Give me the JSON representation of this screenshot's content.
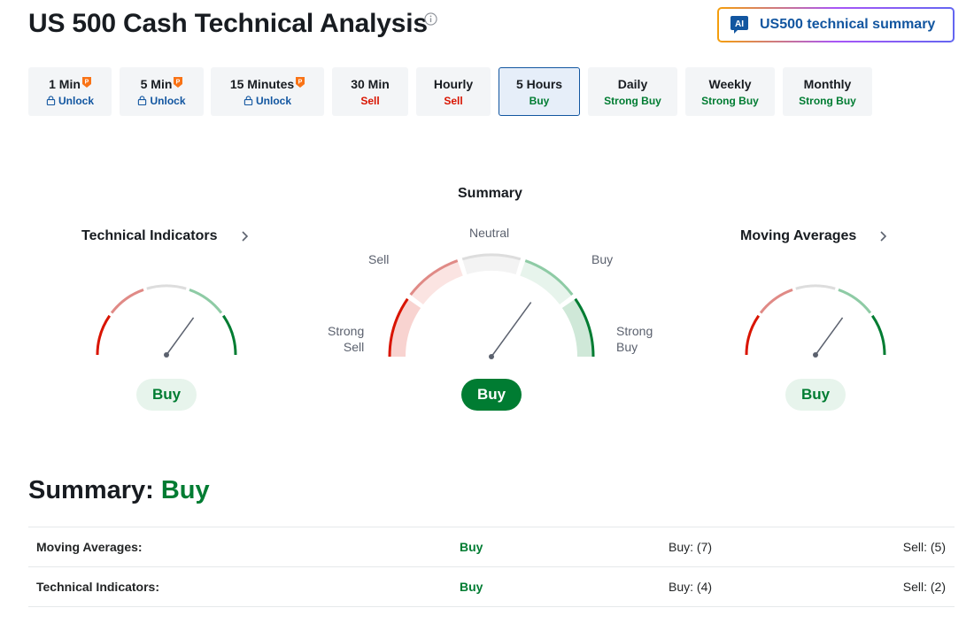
{
  "header": {
    "title": "US 500 Cash Technical Analysis",
    "ai_badge": "AI",
    "ai_summary_label": "US500 technical summary"
  },
  "timeframes": [
    {
      "name": "1 Min",
      "status": "Unlock",
      "locked": true
    },
    {
      "name": "5 Min",
      "status": "Unlock",
      "locked": true
    },
    {
      "name": "15 Minutes",
      "status": "Unlock",
      "locked": true
    },
    {
      "name": "30 Min",
      "status": "Sell",
      "locked": false
    },
    {
      "name": "Hourly",
      "status": "Sell",
      "locked": false
    },
    {
      "name": "5 Hours",
      "status": "Buy",
      "locked": false,
      "active": true
    },
    {
      "name": "Daily",
      "status": "Strong Buy",
      "locked": false
    },
    {
      "name": "Weekly",
      "status": "Strong Buy",
      "locked": false
    },
    {
      "name": "Monthly",
      "status": "Strong Buy",
      "locked": false
    }
  ],
  "gauges": {
    "technical_indicators": {
      "title": "Technical Indicators",
      "result": "Buy",
      "needle": 0.7
    },
    "summary": {
      "title": "Summary",
      "result": "Buy",
      "needle": 0.7,
      "labels": {
        "neutral": "Neutral",
        "sell": "Sell",
        "buy": "Buy",
        "strong_sell": "Strong\nSell",
        "strong_buy": "Strong\nBuy"
      }
    },
    "moving_averages": {
      "title": "Moving Averages",
      "result": "Buy",
      "needle": 0.7
    }
  },
  "summary": {
    "label": "Summary:",
    "value": "Buy",
    "rows": [
      {
        "name": "Moving Averages:",
        "result": "Buy",
        "buy": "Buy: (7)",
        "sell": "Sell: (5)"
      },
      {
        "name": "Technical Indicators:",
        "result": "Buy",
        "buy": "Buy: (4)",
        "sell": "Sell: (2)"
      }
    ]
  },
  "colors": {
    "strong_sell": "#d91400",
    "sell": "#e08a86",
    "neutral": "#dddddd",
    "buy": "#8ecba5",
    "strong_buy": "#007c32",
    "accent": "#1256a0"
  }
}
